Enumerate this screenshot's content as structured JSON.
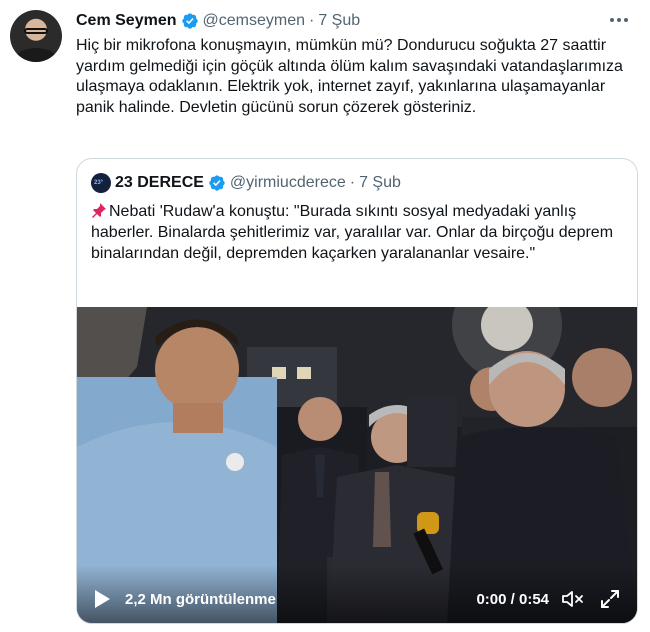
{
  "tweet": {
    "author_name": "Cem Seymen",
    "author_handle": "@cemseymen",
    "separator": "·",
    "time": "7 Şub",
    "text": "Hiç bir mikrofona konuşmayın, mümkün mü? Dondurucu soğukta 27 saattir yardım gelmediği için göçük altında ölüm kalım savaşındaki vatandaşlarımıza ulaşmaya odaklanın. Elektrik yok, internet zayıf, yakınlarına  ulaşamayanlar panik halinde. Devletin gücünü sorun çözerek gösteriniz."
  },
  "quote": {
    "author_name": "23 DERECE",
    "author_handle": "@yirmiucderece",
    "separator": "·",
    "time": "7 Şub",
    "text": "Nebati 'Rudaw'a konuştu: \"Burada sıkıntı sosyal medyadaki yanlış haberler. Binalarda şehitlerimiz var, yaralılar var. Onlar da birçoğu deprem binalarından değil, depremden kaçarken yaralananlar vesaire.\"",
    "video": {
      "views": "2,2 Mn görüntülenme",
      "timecode": "0:00 / 0:54"
    }
  },
  "colors": {
    "verified": "#1d9bf0",
    "secondary_text": "#536471",
    "border": "#cfd9de"
  },
  "icons": [
    "verified-badge-icon",
    "more-icon",
    "pushpin-icon",
    "play-icon",
    "mute-icon",
    "fullscreen-icon"
  ]
}
